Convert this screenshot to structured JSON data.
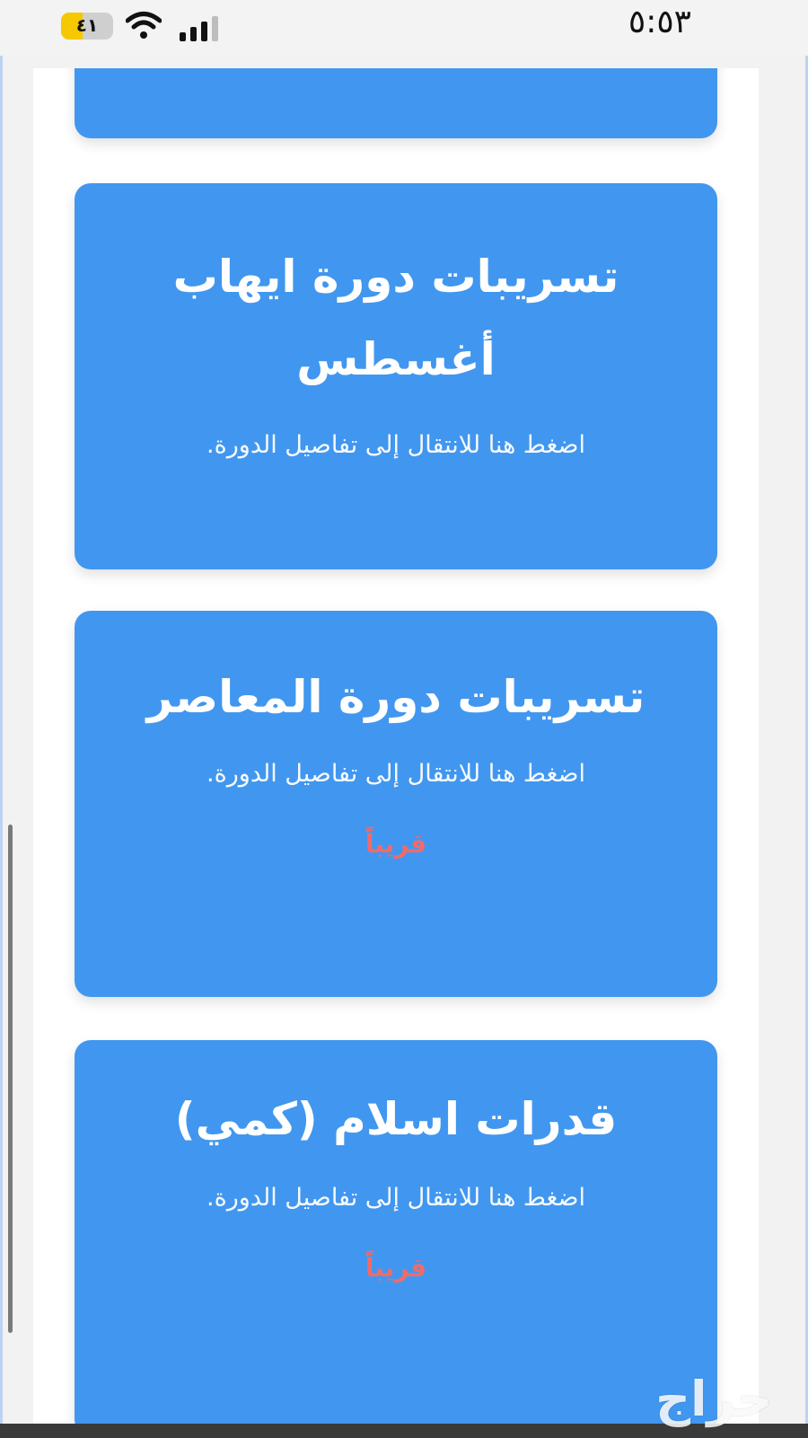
{
  "status_bar": {
    "time": "٥:٥٣",
    "battery_level": "٤١",
    "battery_fill_percent": 41
  },
  "cards": [
    {
      "title": "",
      "description": "",
      "badge": ""
    },
    {
      "title": "تسريبات دورة ايهاب أغسطس",
      "description": "اضغط هنا للانتقال إلى تفاصيل الدورة.",
      "badge": ""
    },
    {
      "title": "تسريبات دورة المعاصر",
      "description": "اضغط هنا للانتقال إلى تفاصيل الدورة.",
      "badge": "قريباً"
    },
    {
      "title": "قدرات اسلام (كمي)",
      "description": "اضغط هنا للانتقال إلى تفاصيل الدورة.",
      "badge": "قريباً"
    }
  ],
  "watermark": "حراج",
  "colors": {
    "card_background": "#4197ef",
    "badge_text": "#ef6b6b",
    "battery": "#f5c800"
  }
}
